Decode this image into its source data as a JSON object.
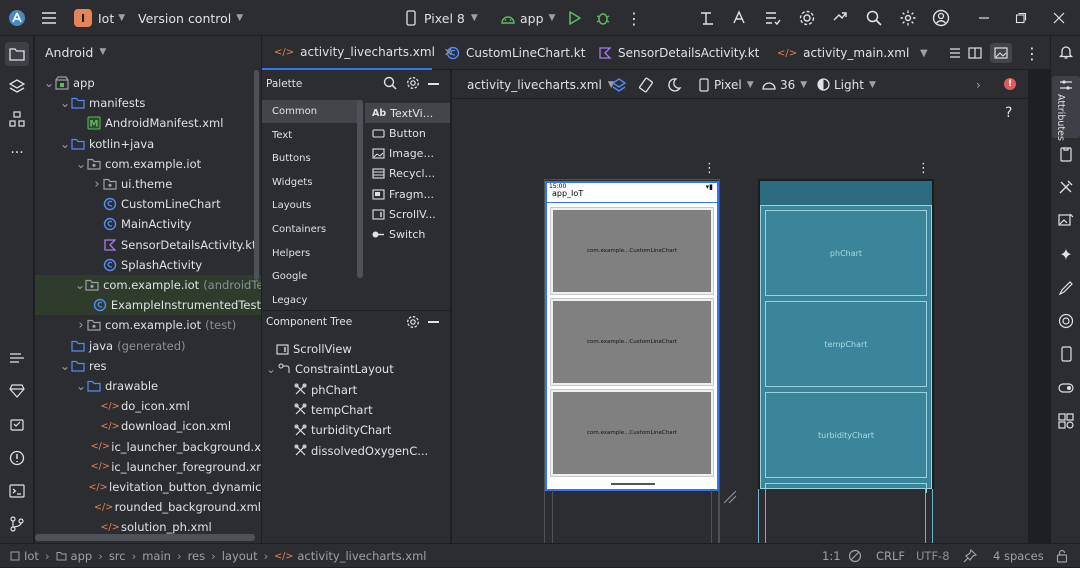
{
  "topbar": {
    "project_initial": "I",
    "project_name": "Iot",
    "vcs_label": "Version control",
    "device": "Pixel 8",
    "run_config": "app"
  },
  "editor_tabs": [
    {
      "label": "activity_livecharts.xml",
      "icon": "xml-icon"
    },
    {
      "label": "CustomLineChart.kt",
      "icon": "kotlin-class-icon"
    },
    {
      "label": "SensorDetailsActivity.kt",
      "icon": "kotlin-file-icon"
    },
    {
      "label": "activity_main.xml",
      "icon": "xml-icon"
    }
  ],
  "project_panel": {
    "title": "Android",
    "tree": [
      {
        "label": "app",
        "icon": "module-icon",
        "depth": 0,
        "expanded": true
      },
      {
        "label": "manifests",
        "icon": "folder-icon",
        "depth": 1,
        "expanded": true
      },
      {
        "label": "AndroidManifest.xml",
        "icon": "manifest-icon",
        "depth": 2
      },
      {
        "label": "kotlin+java",
        "icon": "folder-icon",
        "depth": 1,
        "expanded": true
      },
      {
        "label": "com.example.iot",
        "icon": "package-icon",
        "depth": 2,
        "expanded": true
      },
      {
        "label": "ui.theme",
        "icon": "package-icon",
        "depth": 3,
        "expanded": false
      },
      {
        "label": "CustomLineChart",
        "icon": "kotlin-class-icon",
        "depth": 3
      },
      {
        "label": "MainActivity",
        "icon": "kotlin-class-icon",
        "depth": 3
      },
      {
        "label": "SensorDetailsActivity.kt",
        "icon": "kotlin-file-icon",
        "depth": 3
      },
      {
        "label": "SplashActivity",
        "icon": "kotlin-class-icon",
        "depth": 3
      },
      {
        "label": "com.example.iot",
        "suffix": "(androidTest)",
        "icon": "package-icon",
        "depth": 2,
        "expanded": true,
        "highlight": true
      },
      {
        "label": "ExampleInstrumentedTest",
        "icon": "kotlin-class-icon",
        "depth": 3,
        "highlight": true
      },
      {
        "label": "com.example.iot",
        "suffix": "(test)",
        "icon": "package-icon",
        "depth": 2,
        "expanded": false
      },
      {
        "label": "java",
        "suffix": "(generated)",
        "icon": "folder-icon",
        "depth": 1
      },
      {
        "label": "res",
        "icon": "folder-icon",
        "depth": 1,
        "expanded": true
      },
      {
        "label": "drawable",
        "icon": "folder-icon",
        "depth": 2,
        "expanded": true
      },
      {
        "label": "do_icon.xml",
        "icon": "xml-icon",
        "depth": 3
      },
      {
        "label": "download_icon.xml",
        "icon": "xml-icon",
        "depth": 3
      },
      {
        "label": "ic_launcher_background.x",
        "icon": "xml-icon",
        "depth": 3
      },
      {
        "label": "ic_launcher_foreground.xr",
        "icon": "xml-icon",
        "depth": 3
      },
      {
        "label": "levitation_button_dynamic",
        "icon": "xml-icon",
        "depth": 3
      },
      {
        "label": "rounded_background.xml",
        "icon": "xml-icon",
        "depth": 3
      },
      {
        "label": "solution_ph.xml",
        "icon": "xml-icon",
        "depth": 3
      }
    ]
  },
  "palette": {
    "title": "Palette",
    "categories": [
      "Common",
      "Text",
      "Buttons",
      "Widgets",
      "Layouts",
      "Containers",
      "Helpers",
      "Google",
      "Legacy"
    ],
    "selected_category": "Common",
    "items": [
      {
        "label": "TextVi...",
        "icon": "text-ab-icon"
      },
      {
        "label": "Button",
        "icon": "button-icon"
      },
      {
        "label": "Image...",
        "icon": "image-icon"
      },
      {
        "label": "Recycl...",
        "icon": "recycler-icon"
      },
      {
        "label": "Fragm...",
        "icon": "fragment-icon"
      },
      {
        "label": "ScrollV...",
        "icon": "scroll-icon"
      },
      {
        "label": "Switch",
        "icon": "switch-icon"
      }
    ]
  },
  "component_tree": {
    "title": "Component Tree",
    "nodes": [
      {
        "label": "ScrollView",
        "depth": 0,
        "icon": "scroll-icon"
      },
      {
        "label": "ConstraintLayout",
        "depth": 0,
        "icon": "constraint-icon",
        "expanded": true
      },
      {
        "label": "phChart",
        "depth": 1,
        "icon": "custom-view-icon"
      },
      {
        "label": "tempChart",
        "depth": 1,
        "icon": "custom-view-icon"
      },
      {
        "label": "turbidityChart",
        "depth": 1,
        "icon": "custom-view-icon"
      },
      {
        "label": "dissolvedOxygenC...",
        "depth": 1,
        "icon": "custom-view-icon"
      }
    ]
  },
  "design_toolbar": {
    "file": "activity_livecharts.xml",
    "device": "Pixel",
    "api": "36",
    "theme": "Light"
  },
  "canvas": {
    "design_preview": {
      "status_time": "15:00",
      "app_title": "app_IoT",
      "chart_label": "com.example...CustomLineChart"
    },
    "blueprint_preview": {
      "charts": [
        "phChart",
        "tempChart",
        "turbidityChart"
      ]
    },
    "side_label": "Attributes"
  },
  "statusbar": {
    "breadcrumbs": [
      "Iot",
      "app",
      "src",
      "main",
      "res",
      "layout",
      "activity_livecharts.xml"
    ],
    "position": "1:1",
    "line_sep": "CRLF",
    "encoding": "UTF-8",
    "indent": "4 spaces"
  },
  "colors": {
    "accent": "#3574f0",
    "project_badge": "#e5845a",
    "blueprint": "#3a7d8f",
    "highlight_row": "#2f3b2b"
  }
}
